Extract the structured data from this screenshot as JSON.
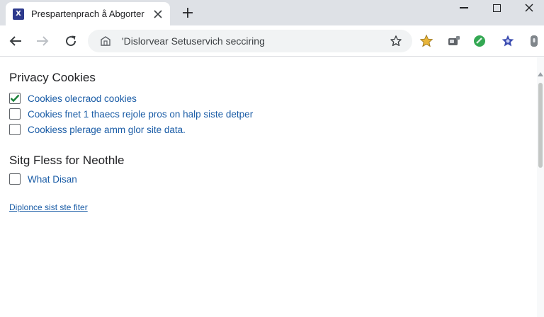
{
  "browser": {
    "tab": {
      "title": "Prespartenprach å Abgorter",
      "favicon_glyph": "X"
    },
    "new_tab_label": "+",
    "address_bar": {
      "url": "'Dislorvear Setuservich secciring"
    }
  },
  "page": {
    "privacy_section": {
      "title": "Privacy Cookies",
      "options": [
        {
          "label": "Cookies olecraod cookies",
          "checked": true
        },
        {
          "label": "Cookies fnet 1 thaecs rejole pros on halp siste detper",
          "checked": false
        },
        {
          "label": "Cookiess plerage amm glor site data.",
          "checked": false
        }
      ]
    },
    "site_section": {
      "title": "Sitg Fless for Neothle",
      "options": [
        {
          "label": "What Disan",
          "checked": false
        }
      ]
    },
    "footer_link": "Diplonce sist ste fiter"
  },
  "colors": {
    "tabstrip_bg": "#dee1e6",
    "link_blue": "#1a5ca6",
    "checkbox_check": "#188038"
  },
  "icons": [
    "x-app-favicon",
    "close-icon",
    "plus-icon",
    "minimize-icon",
    "maximize-icon",
    "window-close-icon",
    "back-arrow-icon",
    "forward-arrow-icon",
    "reload-icon",
    "site-info-icon",
    "star-icon",
    "extension-star-icon",
    "extension-camera-icon",
    "extension-green-icon",
    "extension-blue-star-icon",
    "extension-lock-icon"
  ]
}
